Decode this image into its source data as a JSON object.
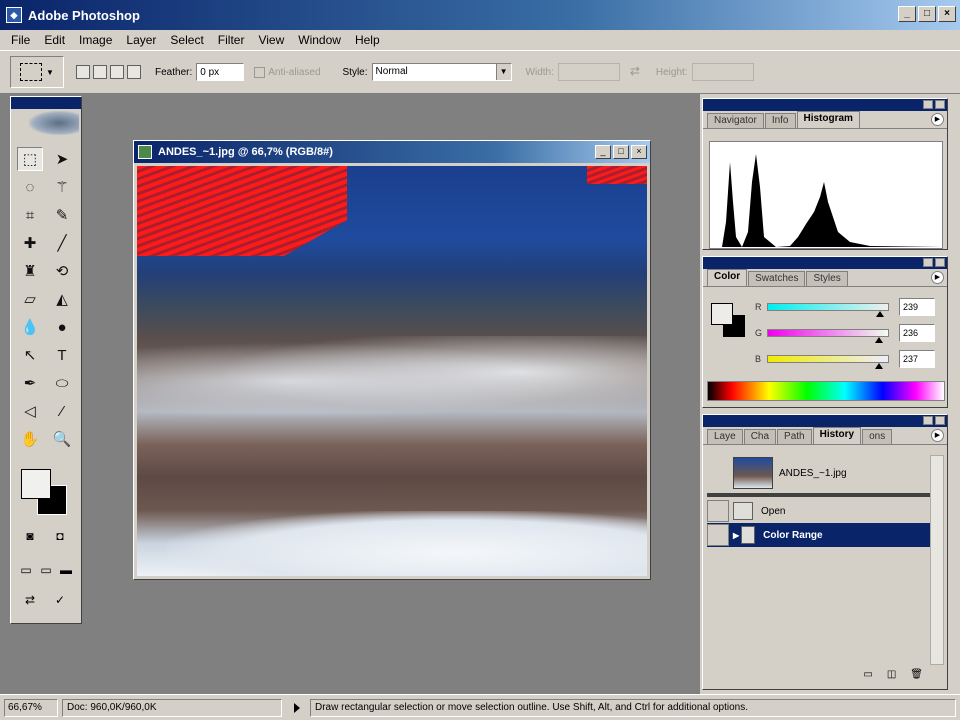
{
  "app": {
    "title": "Adobe Photoshop"
  },
  "menu": [
    "File",
    "Edit",
    "Image",
    "Layer",
    "Select",
    "Filter",
    "View",
    "Window",
    "Help"
  ],
  "options": {
    "feather_label": "Feather:",
    "feather_value": "0 px",
    "antialiased_label": "Anti-aliased",
    "style_label": "Style:",
    "style_value": "Normal",
    "width_label": "Width:",
    "height_label": "Height:"
  },
  "document": {
    "title": "ANDES_~1.jpg @ 66,7% (RGB/8#)",
    "selection_color": "#ff1a1a"
  },
  "panels": {
    "navigator": {
      "tabs": [
        "Navigator",
        "Info",
        "Histogram"
      ],
      "active_tab": "Histogram"
    },
    "color": {
      "tabs": [
        "Color",
        "Swatches",
        "Styles"
      ],
      "active_tab": "Color",
      "channels": [
        {
          "label": "R",
          "value": "239",
          "fraction": 0.937,
          "color_from": "#00efee",
          "color_to": "#efefee"
        },
        {
          "label": "G",
          "value": "236",
          "fraction": 0.925,
          "color_from": "#ef00ee",
          "color_to": "#efffee"
        },
        {
          "label": "B",
          "value": "237",
          "fraction": 0.929,
          "color_from": "#efec00",
          "color_to": "#efecff"
        }
      ]
    },
    "history": {
      "tabs": [
        "Laye",
        "Cha",
        "Path",
        "History",
        "ons"
      ],
      "active_tab": "History",
      "snapshot": "ANDES_~1.jpg",
      "items": [
        {
          "label": "Open",
          "selected": false
        },
        {
          "label": "Color Range",
          "selected": true
        }
      ]
    }
  },
  "status": {
    "zoom": "66,67%",
    "doc_size": "Doc: 960,0K/960,0K",
    "message": "Draw rectangular selection or move selection outline.  Use Shift, Alt, and Ctrl for additional options."
  }
}
